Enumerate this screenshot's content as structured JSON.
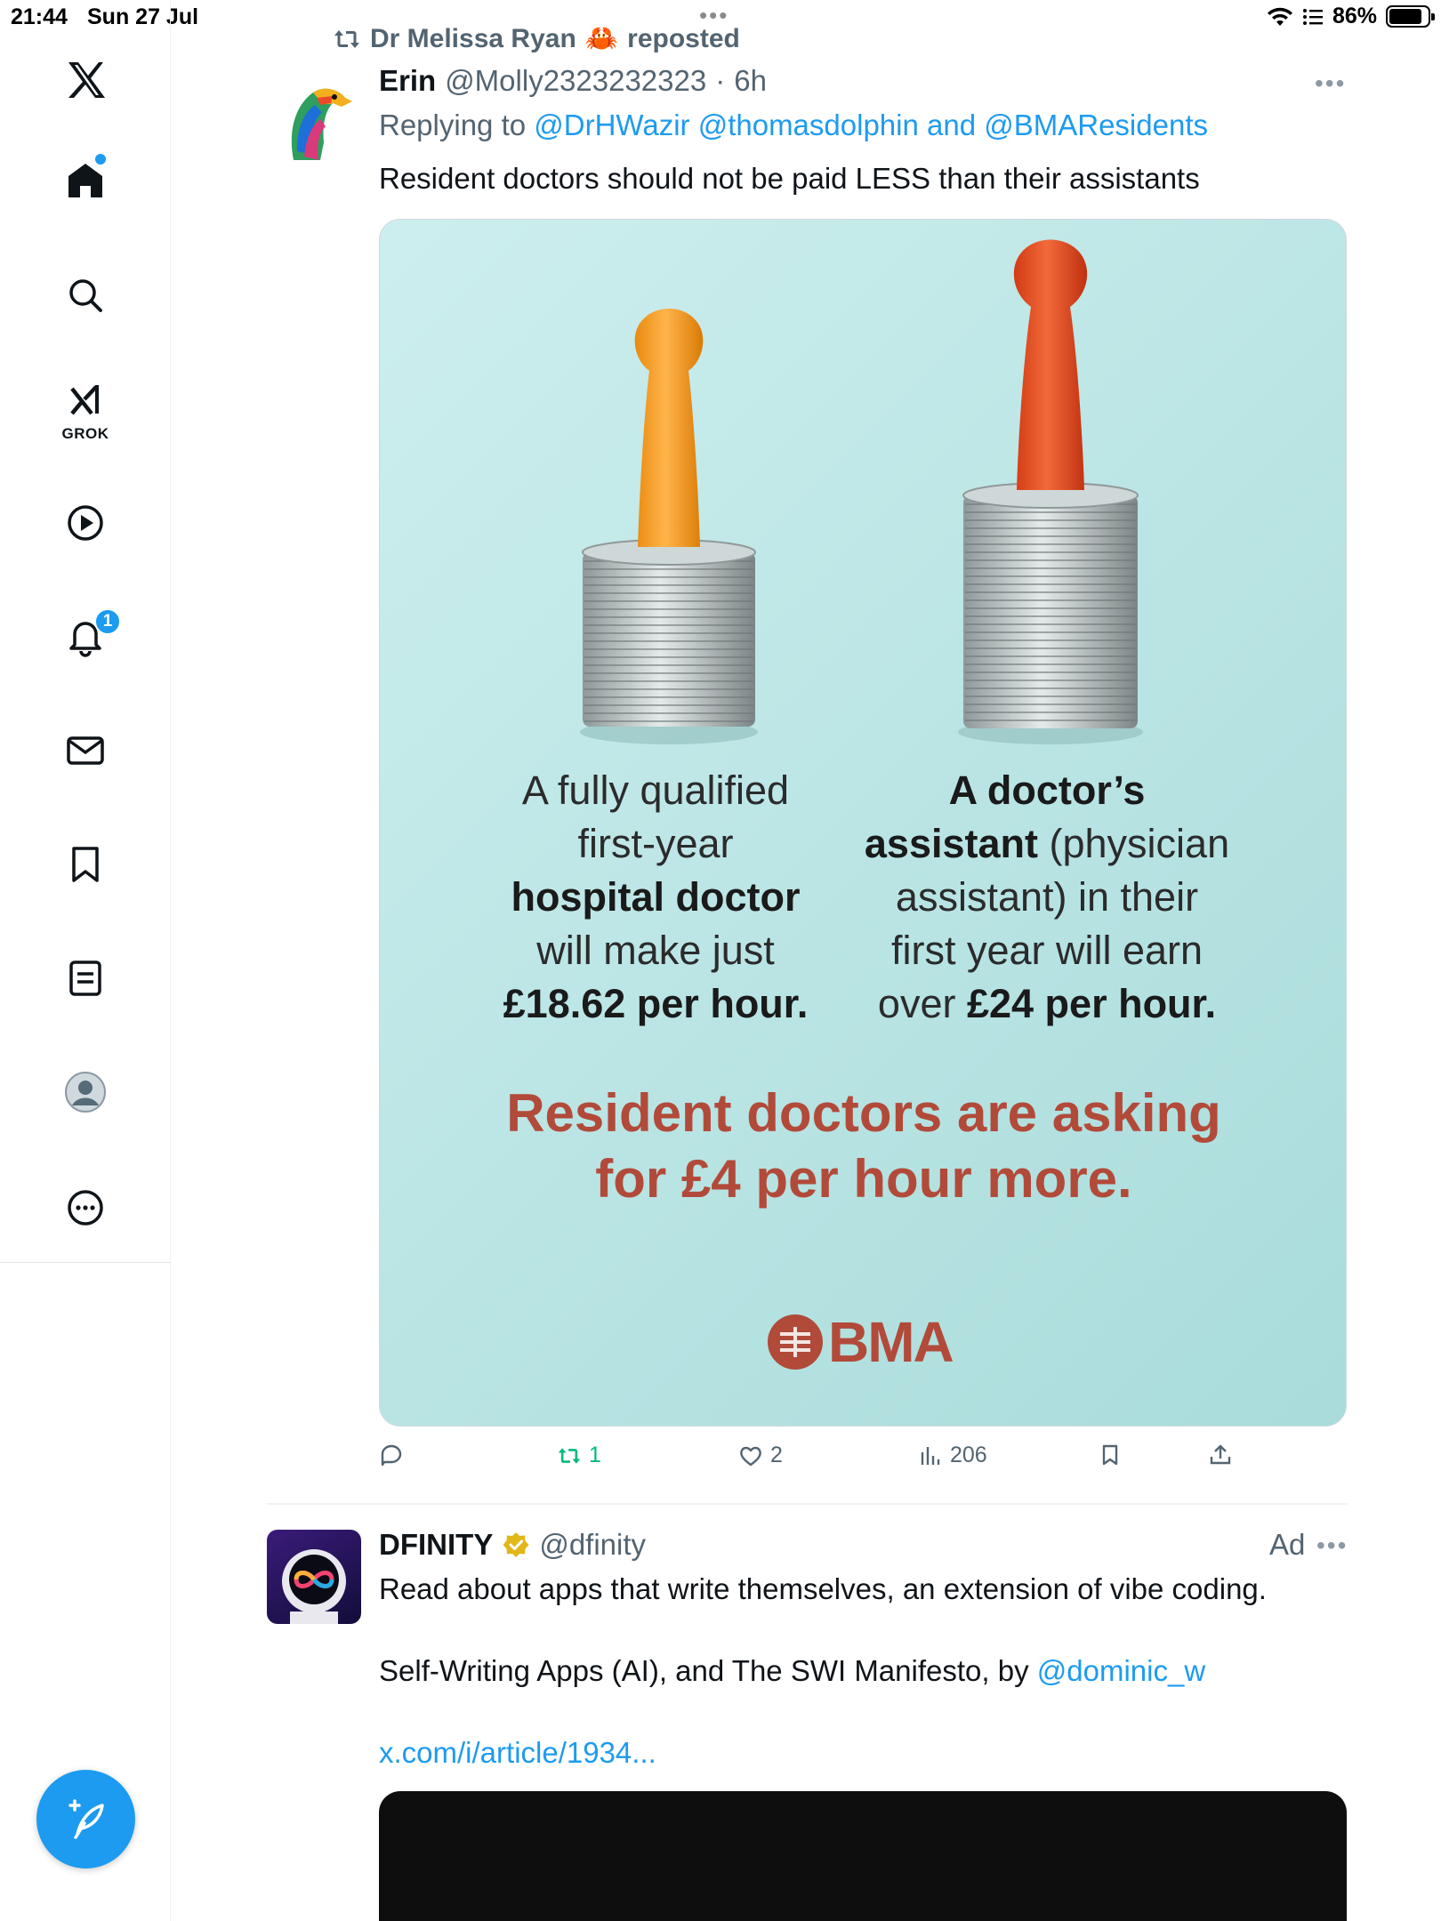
{
  "status_bar": {
    "time": "21:44",
    "date": "Sun 27 Jul",
    "battery": "86%",
    "battery_fraction": 0.86
  },
  "sidebar": {
    "items": [
      {
        "name": "x-logo",
        "icon": "x-logo-icon"
      },
      {
        "name": "home",
        "icon": "home-icon",
        "has_dot": true
      },
      {
        "name": "search",
        "icon": "search-icon"
      },
      {
        "name": "grok",
        "icon": "grok-icon",
        "label": "GROK"
      },
      {
        "name": "videos",
        "icon": "play-icon"
      },
      {
        "name": "notifications",
        "icon": "bell-icon",
        "badge": "1"
      },
      {
        "name": "messages",
        "icon": "mail-icon"
      },
      {
        "name": "bookmarks",
        "icon": "bookmark-icon"
      },
      {
        "name": "lists",
        "icon": "list-icon"
      },
      {
        "name": "profile",
        "icon": "profile-icon"
      },
      {
        "name": "more",
        "icon": "more-icon"
      }
    ],
    "compose_icon": "compose-icon"
  },
  "tweet": {
    "repost_by": "Dr Melissa Ryan",
    "repost_emoji": "🦀",
    "repost_suffix": "reposted",
    "author_name": "Erin",
    "author_handle": "@Molly2323232323",
    "time": "6h",
    "replying_prefix": "Replying to",
    "replying_mentions": "@DrHWazir @thomasdolphin and @BMAResidents",
    "text": "Resident doctors should not be paid LESS than their assistants",
    "media": {
      "left_line1": "A fully qualified",
      "left_line2": "first-year",
      "left_line3": "hospital doctor",
      "left_line4": "will make just",
      "left_line5": "£18.62 per hour.",
      "right_line1_bold": "A doctor’s",
      "right_line2_bold": "assistant",
      "right_line2_rest": " (physician",
      "right_line3": "assistant) in their",
      "right_line4": "first year will earn",
      "right_line5_pre": "over ",
      "right_line5_bold": "£24 per hour.",
      "headline_line1": "Resident doctors are asking",
      "headline_line2": "for £4 per hour more.",
      "logo_text": "BMA",
      "colors": {
        "background": "#bfe7e6",
        "headline": "#b24a3a",
        "left_pawn": "#f39a1c",
        "right_pawn": "#e4461f"
      }
    },
    "actions": {
      "reply_count": "",
      "repost_count": "1",
      "like_count": "2",
      "views_count": "206"
    }
  },
  "ad_tweet": {
    "author_name": "DFINITY",
    "verified": true,
    "author_handle": "@dfinity",
    "ad_label": "Ad",
    "line1": "Read about apps that write themselves, an extension of vibe coding.",
    "line2_prefix": "Self-Writing Apps (AI), and The SWI Manifesto, by ",
    "line2_mention": "@dominic_w",
    "link": "x.com/i/article/1934..."
  },
  "colors": {
    "accent": "#1d9bf0",
    "repost_green": "#00ba7c",
    "secondary_text": "#536471",
    "verified_gold": "#e2b719"
  }
}
